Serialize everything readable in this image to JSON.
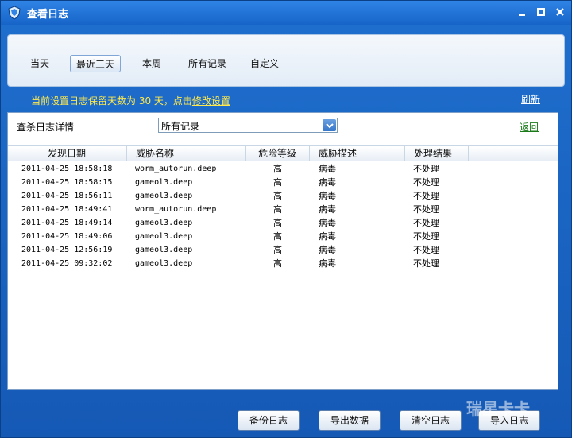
{
  "window": {
    "title": "查看日志",
    "controls": {
      "minimize": "▬",
      "maximize": "□",
      "close": "✕"
    }
  },
  "tabs": [
    {
      "label": "当天"
    },
    {
      "label": "最近三天"
    },
    {
      "label": "本周"
    },
    {
      "label": "所有记录"
    },
    {
      "label": "自定义"
    }
  ],
  "info": {
    "text": "当前设置日志保留天数为 30 天，点击",
    "link": "修改设置"
  },
  "refresh_label": "刷新",
  "filter": {
    "label": "查杀日志详情",
    "value": "所有记录",
    "back_label": "返回"
  },
  "table": {
    "headers": [
      "发现日期",
      "威胁名称",
      "危险等级",
      "威胁描述",
      "处理结果"
    ],
    "rows": [
      [
        "2011-04-25 18:58:18",
        "worm_autorun.deep",
        "高",
        "病毒",
        "不处理"
      ],
      [
        "2011-04-25 18:58:15",
        "gameol3.deep",
        "高",
        "病毒",
        "不处理"
      ],
      [
        "2011-04-25 18:56:11",
        "gameol3.deep",
        "高",
        "病毒",
        "不处理"
      ],
      [
        "2011-04-25 18:49:41",
        "worm_autorun.deep",
        "高",
        "病毒",
        "不处理"
      ],
      [
        "2011-04-25 18:49:14",
        "gameol3.deep",
        "高",
        "病毒",
        "不处理"
      ],
      [
        "2011-04-25 18:49:06",
        "gameol3.deep",
        "高",
        "病毒",
        "不处理"
      ],
      [
        "2011-04-25 12:56:19",
        "gameol3.deep",
        "高",
        "病毒",
        "不处理"
      ],
      [
        "2011-04-25 09:32:02",
        "gameol3.deep",
        "高",
        "病毒",
        "不处理"
      ]
    ]
  },
  "buttons": {
    "backup": "备份日志",
    "export": "导出数据",
    "clear": "清空日志",
    "import": "导入日志"
  },
  "watermark": "瑞星卡卡"
}
